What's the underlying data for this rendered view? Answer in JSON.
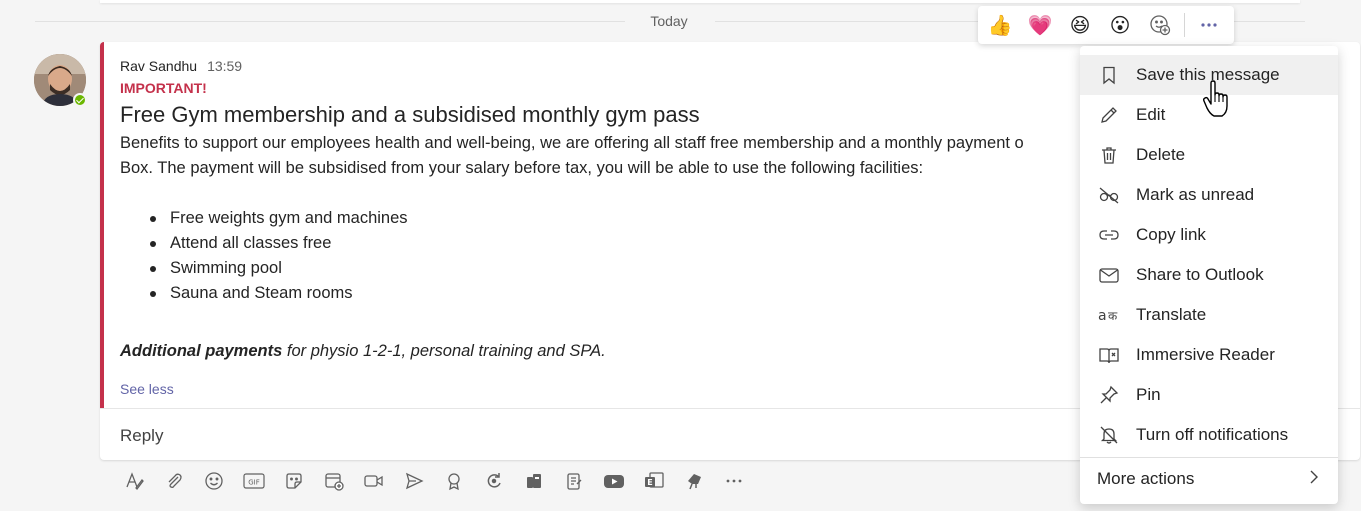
{
  "divider": {
    "label": "Today"
  },
  "message": {
    "sender": "Rav Sandhu",
    "time": "13:59",
    "importance": "IMPORTANT!",
    "subject": "Free Gym membership and a subsidised monthly gym pass",
    "body_line1": "Benefits to support our employees health and well-being, we are offering all staff free membership and a monthly payment o",
    "body_line2": "Box. The payment will be subsidised from your salary before tax, you will be able to use the following facilities:",
    "bullets": [
      "Free weights gym and machines",
      "Attend all classes free",
      "Swimming pool",
      "Sauna and Steam rooms"
    ],
    "additional_bold": "Additional payments",
    "additional_rest": " for physio 1-2-1, personal training and SPA.",
    "see_less": "See less",
    "reply": "Reply",
    "accent_color": "#c4314b",
    "presence_color": "#6bb700"
  },
  "reactions": {
    "items": [
      "👍",
      "💗",
      "😆",
      "😮"
    ],
    "icon_names": [
      "thumbs-up-icon",
      "heart-icon",
      "laugh-icon",
      "surprised-icon",
      "add-reaction-icon",
      "more-options-icon"
    ]
  },
  "context_menu": {
    "items": [
      {
        "label": "Save this message",
        "icon": "bookmark-icon"
      },
      {
        "label": "Edit",
        "icon": "pencil-icon"
      },
      {
        "label": "Delete",
        "icon": "trash-icon"
      },
      {
        "label": "Mark as unread",
        "icon": "unread-icon"
      },
      {
        "label": "Copy link",
        "icon": "link-icon"
      },
      {
        "label": "Share to Outlook",
        "icon": "mail-icon"
      },
      {
        "label": "Translate",
        "icon": "translate-icon"
      },
      {
        "label": "Immersive Reader",
        "icon": "immersive-reader-icon"
      },
      {
        "label": "Pin",
        "icon": "pin-icon"
      },
      {
        "label": "Turn off notifications",
        "icon": "bell-off-icon"
      }
    ],
    "more_actions": "More actions",
    "hovered_index": 0
  },
  "compose_toolbar": {
    "icons": [
      "format-icon",
      "attach-icon",
      "emoji-icon",
      "gif-icon",
      "sticker-icon",
      "schedule-meeting-icon",
      "video-icon",
      "send-icon",
      "praise-icon",
      "loop-icon",
      "stream-icon",
      "forms-icon",
      "youtube-icon",
      "exchange-icon",
      "app-icon",
      "more-icon"
    ]
  },
  "theme": {
    "brand": "#6264a7",
    "accent": "#c4314b"
  }
}
